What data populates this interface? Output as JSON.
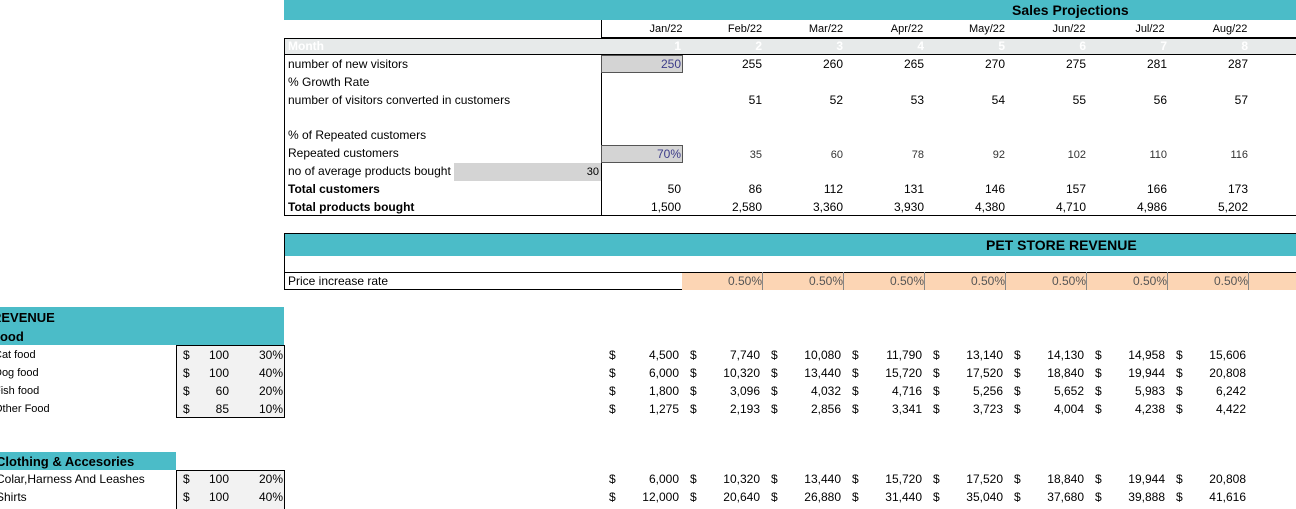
{
  "sales": {
    "title": "Sales Projections",
    "months": [
      "Jan/22",
      "Feb/22",
      "Mar/22",
      "Apr/22",
      "May/22",
      "Jun/22",
      "Jul/22",
      "Aug/22"
    ],
    "month_label": "Month",
    "month_numbers": [
      "1",
      "2",
      "3",
      "4",
      "5",
      "6",
      "7",
      "8"
    ],
    "rows": {
      "new_visitors": {
        "label": "number of new visitors",
        "values": [
          "250",
          "255",
          "260",
          "265",
          "270",
          "275",
          "281",
          "287"
        ]
      },
      "growth_rate": {
        "label": "% Growth Rate"
      },
      "converted": {
        "label": "number of visitors converted in customers",
        "values": [
          "",
          "51",
          "52",
          "53",
          "54",
          "55",
          "56",
          "57"
        ]
      },
      "pct_repeated": {
        "label": "% of Repeated customers"
      },
      "repeated": {
        "label": "Repeated customers",
        "values": [
          "70%",
          "35",
          "60",
          "78",
          "92",
          "102",
          "110",
          "116"
        ]
      },
      "avg_products": {
        "label": "no of average products bought",
        "value": "30"
      },
      "total_customers": {
        "label": "Total customers",
        "values": [
          "50",
          "86",
          "112",
          "131",
          "146",
          "157",
          "166",
          "173"
        ]
      },
      "total_products": {
        "label": "Total products bought",
        "values": [
          "1,500",
          "2,580",
          "3,360",
          "3,930",
          "4,380",
          "4,710",
          "4,986",
          "5,202"
        ]
      }
    }
  },
  "revenue_header": {
    "title": "PET STORE REVENUE",
    "price_increase_label": "Price increase rate",
    "price_increase_values": [
      "0.50%",
      "0.50%",
      "0.50%",
      "0.50%",
      "0.50%",
      "0.50%",
      "0.50%"
    ]
  },
  "revenue": {
    "title": "REVENUE",
    "food": {
      "title": "Food",
      "items": [
        {
          "label": "Cat food",
          "currency": "$",
          "price": "100",
          "pct": "30%",
          "values": [
            "4,500",
            "7,740",
            "10,080",
            "11,790",
            "13,140",
            "14,130",
            "14,958",
            "15,606"
          ]
        },
        {
          "label": "Dog food",
          "currency": "$",
          "price": "100",
          "pct": "40%",
          "values": [
            "6,000",
            "10,320",
            "13,440",
            "15,720",
            "17,520",
            "18,840",
            "19,944",
            "20,808"
          ]
        },
        {
          "label": "Fish food",
          "currency": "$",
          "price": "60",
          "pct": "20%",
          "values": [
            "1,800",
            "3,096",
            "4,032",
            "4,716",
            "5,256",
            "5,652",
            "5,983",
            "6,242"
          ]
        },
        {
          "label": "Other Food",
          "currency": "$",
          "price": "85",
          "pct": "10%",
          "values": [
            "1,275",
            "2,193",
            "2,856",
            "3,341",
            "3,723",
            "4,004",
            "4,238",
            "4,422"
          ]
        }
      ]
    },
    "clothing": {
      "title": "Clothing & Accesories",
      "items": [
        {
          "label": "Colar,Harness And Leashes",
          "currency": "$",
          "price": "100",
          "pct": "20%",
          "values": [
            "6,000",
            "10,320",
            "13,440",
            "15,720",
            "17,520",
            "18,840",
            "19,944",
            "20,808"
          ]
        },
        {
          "label": "Shirts",
          "currency": "$",
          "price": "100",
          "pct": "40%",
          "values": [
            "12,000",
            "20,640",
            "26,880",
            "31,440",
            "35,040",
            "37,680",
            "39,888",
            "41,616"
          ]
        }
      ]
    }
  },
  "colors": {
    "teal": "#4bbcc8",
    "orange_fill": "#fcd5b4",
    "gray_fill": "#d4d4d4"
  }
}
